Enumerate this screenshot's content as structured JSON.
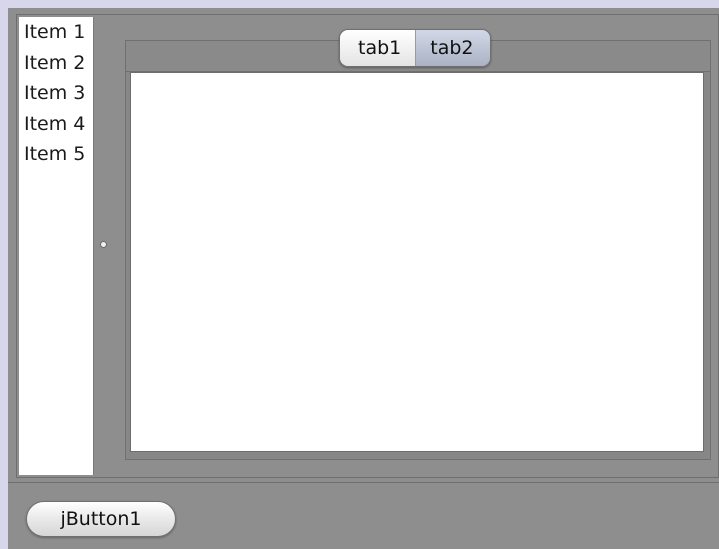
{
  "list": {
    "items": [
      {
        "label": "Item 1"
      },
      {
        "label": "Item 2"
      },
      {
        "label": "Item 3"
      },
      {
        "label": "Item 4"
      },
      {
        "label": "Item 5"
      }
    ]
  },
  "tabs": [
    {
      "label": "tab1",
      "selected": false
    },
    {
      "label": "tab2",
      "selected": true
    }
  ],
  "buttons": {
    "jbutton1_label": "jButton1"
  },
  "colors": {
    "window_background": "#8e8e8e",
    "list_background": "#ffffff",
    "tab_content_background": "#ffffff",
    "selected_tab": "#aab2c4",
    "outer_border": "#d8d6ea"
  },
  "icons": {
    "divider_handle": "split-divider-grip-icon"
  }
}
